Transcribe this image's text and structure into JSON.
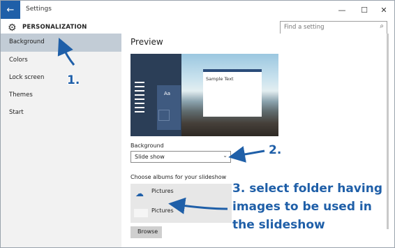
{
  "window": {
    "app_title": "Settings",
    "minimize_glyph": "—",
    "maximize_glyph": "☐",
    "close_glyph": "✕"
  },
  "header": {
    "title": "PERSONALIZATION",
    "search_placeholder": "Find a setting"
  },
  "sidebar": {
    "items": [
      {
        "label": "Background"
      },
      {
        "label": "Colors"
      },
      {
        "label": "Lock screen"
      },
      {
        "label": "Themes"
      },
      {
        "label": "Start"
      }
    ]
  },
  "main": {
    "preview_title": "Preview",
    "preview_aa": "Aa",
    "preview_sample_text": "Sample Text",
    "background_label": "Background",
    "background_value": "Slide show",
    "albums_label": "Choose albums for your slideshow",
    "albums": [
      {
        "name": "Pictures"
      },
      {
        "name": "Pictures"
      }
    ],
    "browse_label": "Browse"
  },
  "annotations": {
    "step1": "1.",
    "step2": "2.",
    "step3_line1": "3. select folder having",
    "step3_line2": "images to be used in",
    "step3_line3": "the slideshow"
  },
  "colors": {
    "accent": "#1f5fa8",
    "active_sidebar": "#c2ccd6"
  }
}
